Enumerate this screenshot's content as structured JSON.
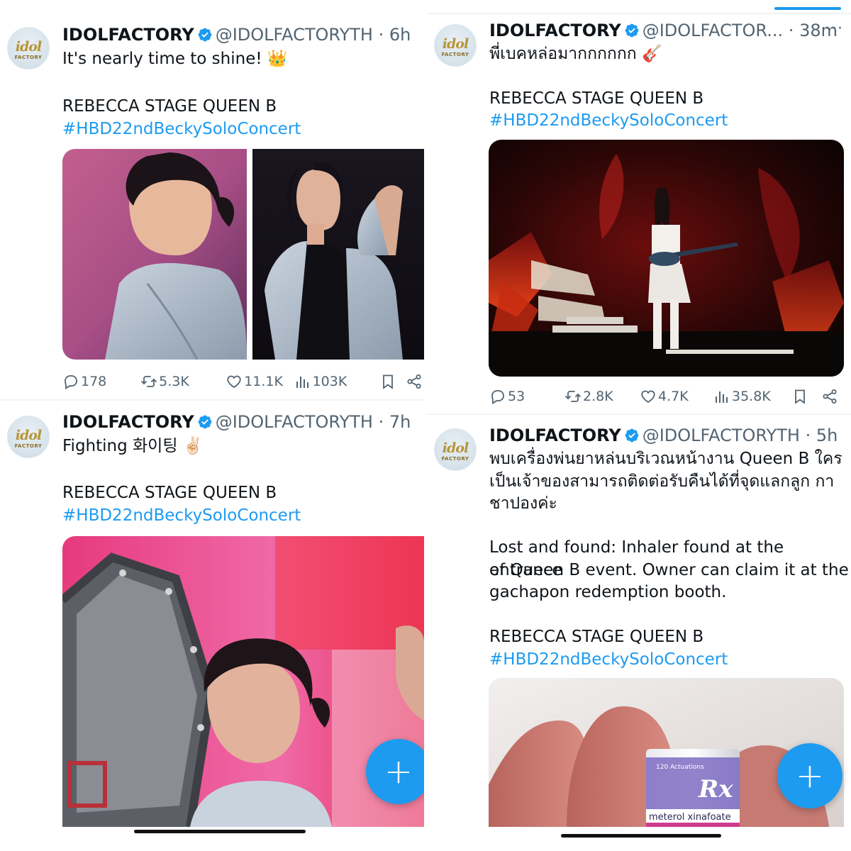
{
  "colors": {
    "accent": "#1d9bf0",
    "text": "#0f1419",
    "muted": "#536471",
    "verified": "#1d9bf0"
  },
  "posts": [
    {
      "avatar_text": "idol",
      "avatar_sub": "FACTORY",
      "name": "IDOLFACTORY",
      "handle": "@IDOLFACTORYTH",
      "dot": "·",
      "time": "6h",
      "line1": "It's nearly time to shine! 👑",
      "line2": "REBECCA STAGE QUEEN B",
      "hashtag": "#HBD22ndBeckySoloConcert",
      "replies": "178",
      "reposts": "5.3K",
      "likes": "11.1K",
      "views": "103K"
    },
    {
      "avatar_text": "idol",
      "avatar_sub": "FACTORY",
      "name": "IDOLFACTORY",
      "handle": "@IDOLFACTOR...",
      "dot": "·",
      "time": "38m",
      "line1": "พี่เบคหล่อมากกกกกก 🎸",
      "line2": "REBECCA STAGE QUEEN B",
      "hashtag": "#HBD22ndBeckySoloConcert",
      "replies": "53",
      "reposts": "2.8K",
      "likes": "4.7K",
      "views": "35.8K"
    },
    {
      "avatar_text": "idol",
      "avatar_sub": "FACTORY",
      "name": "IDOLFACTORY",
      "handle": "@IDOLFACTORYTH",
      "dot": "·",
      "time": "7h",
      "line1": "Fighting 화이팅 ✌🏻",
      "line2": "REBECCA STAGE QUEEN B",
      "hashtag": "#HBD22ndBeckySoloConcert"
    },
    {
      "avatar_text": "idol",
      "avatar_sub": "FACTORY",
      "name": "IDOLFACTORY",
      "handle": "@IDOLFACTORYTH",
      "dot": "·",
      "time": "5h",
      "thai1": "พบเครื่องพ่นยาหล่นบริเวณหน้างาน Queen B ใคร",
      "thai2": "เป็นเจ้าของสามารถติดต่อรับคืนได้ที่จุดแลกลูก กา",
      "thai3": "ชาปองค่ะ",
      "en1": "Lost and found: Inhaler found at the entrance",
      "en2": "of Queen B event. Owner can claim it at the",
      "en3": "gachapon redemption booth.",
      "line2": "REBECCA STAGE QUEEN B",
      "hashtag": "#HBD22ndBeckySoloConcert",
      "photo_can_top": "120 Actuations",
      "photo_can_logo": "Rx",
      "photo_can_label": "meterol xinafoate"
    }
  ],
  "fab_label": "+"
}
